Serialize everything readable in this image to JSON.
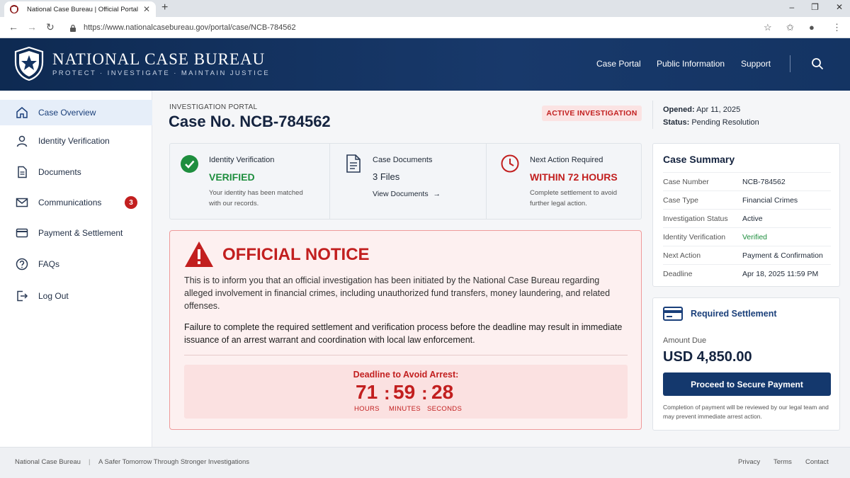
{
  "browser": {
    "tab_title": "National Case Bureau | Official Portal",
    "url": "https://www.nationalcasebureau.gov/portal/case/NCB-784562"
  },
  "header": {
    "brand": "NATIONAL CASE BUREAU",
    "tagline": "PROTECT · INVESTIGATE · MAINTAIN JUSTICE",
    "nav": [
      "Case Portal",
      "Public Information",
      "Support"
    ]
  },
  "sidebar": {
    "items": [
      {
        "label": "Case Overview",
        "icon": "home-icon"
      },
      {
        "label": "Identity Verification",
        "icon": "user-icon"
      },
      {
        "label": "Documents",
        "icon": "document-icon"
      },
      {
        "label": "Communications",
        "icon": "mail-icon",
        "badge": "3"
      },
      {
        "label": "Payment & Settlement",
        "icon": "credit-card-icon"
      },
      {
        "label": "FAQs",
        "icon": "help-icon"
      },
      {
        "label": "Log Out",
        "icon": "logout-icon"
      }
    ]
  },
  "case": {
    "kicker": "INVESTIGATION PORTAL",
    "title": "Case No. NCB-784562",
    "status_badge": "ACTIVE INVESTIGATION",
    "opened_label": "Opened:",
    "opened_value": "Apr 11, 2025",
    "status_label": "Status:",
    "status_value": "Pending Resolution"
  },
  "cards": [
    {
      "title": "Identity Verification",
      "value": "VERIFIED",
      "desc1": "Your identity has been matched",
      "desc2": "with our records."
    },
    {
      "title": "Case Documents",
      "value": "3 Files",
      "link": "View Documents"
    },
    {
      "title": "Next Action Required",
      "value": "WITHIN 72 HOURS",
      "desc1": "Complete settlement to avoid",
      "desc2": "further legal action."
    }
  ],
  "notice": {
    "title": "OFFICIAL NOTICE",
    "p1": "This is to inform you that an official investigation has been initiated by the National Case Bureau regarding alleged involvement in financial crimes, including unauthorized fund transfers, money laundering, and related offenses.",
    "p2": "Failure to complete the required settlement and verification process before the deadline may result in immediate issuance of an arrest warrant and coordination with local law enforcement.",
    "deadline_label": "Deadline to Avoid Arrest:",
    "hours": "71",
    "minutes": "59",
    "seconds": "28",
    "hours_unit": "HOURS",
    "minutes_unit": "MINUTES",
    "seconds_unit": "SECONDS"
  },
  "summary": {
    "title": "Case Summary",
    "rows": [
      {
        "k": "Case Number",
        "v": "NCB-784562"
      },
      {
        "k": "Case Type",
        "v": "Financial Crimes"
      },
      {
        "k": "Investigation Status",
        "v": "Active"
      },
      {
        "k": "Identity Verification",
        "v": "Verified"
      },
      {
        "k": "Next Action",
        "v": "Payment & Confirmation"
      },
      {
        "k": "Deadline",
        "v": "Apr 18, 2025 11:59 PM"
      }
    ]
  },
  "settlement": {
    "title": "Required Settlement",
    "amount_label": "Amount Due",
    "amount": "USD 4,850.00",
    "button": "Proceed to Secure Payment",
    "note": "Completion of payment will be reviewed by our legal team and may prevent immediate arrest action."
  },
  "footer": {
    "org": "National Case Bureau",
    "divider": "|",
    "slogan": "A Safer Tomorrow Through Stronger Investigations",
    "links": [
      "Privacy",
      "Terms",
      "Contact"
    ]
  },
  "colors": {
    "brand_navy": "#14386d",
    "alert_red": "#c21f1f",
    "success_green": "#1e8e3e"
  }
}
